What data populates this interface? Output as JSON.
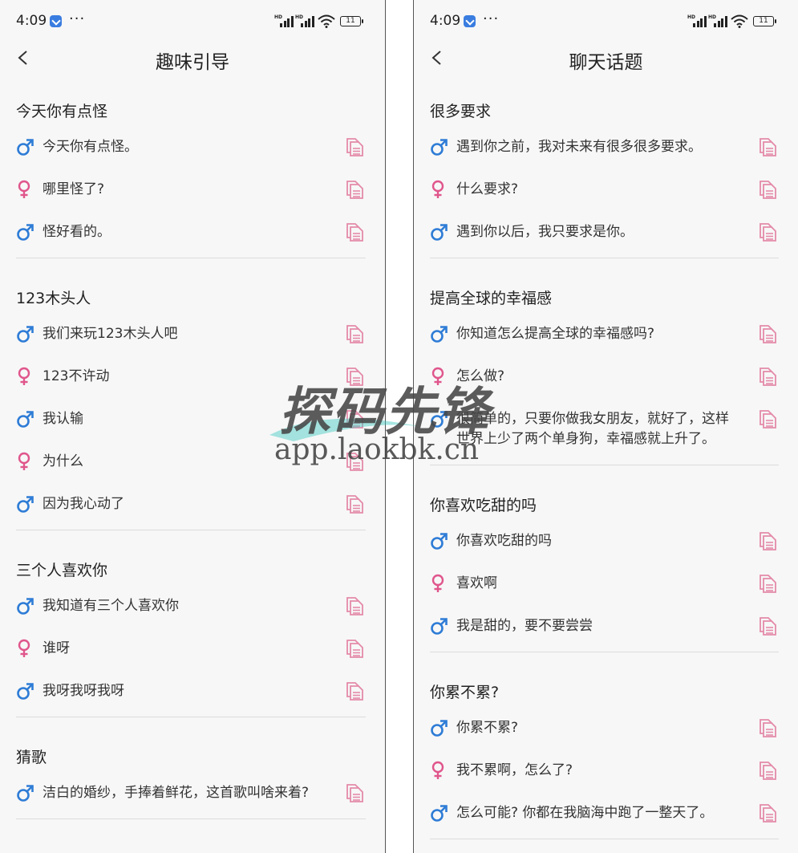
{
  "status": {
    "time": "4:09",
    "dots": "···",
    "battery": "11"
  },
  "colors": {
    "male": "#2e7cd6",
    "female": "#e0568c",
    "copy": "#e48aa8"
  },
  "screens": [
    {
      "title": "趣味引导",
      "sections": [
        {
          "title": "今天你有点怪",
          "items": [
            {
              "gender": "male",
              "text": "今天你有点怪。"
            },
            {
              "gender": "female",
              "text": "哪里怪了?"
            },
            {
              "gender": "male",
              "text": "怪好看的。"
            }
          ]
        },
        {
          "title": "123木头人",
          "items": [
            {
              "gender": "male",
              "text": "我们来玩123木头人吧"
            },
            {
              "gender": "female",
              "text": "123不许动"
            },
            {
              "gender": "male",
              "text": "我认输"
            },
            {
              "gender": "female",
              "text": "为什么"
            },
            {
              "gender": "male",
              "text": "因为我心动了"
            }
          ]
        },
        {
          "title": "三个人喜欢你",
          "items": [
            {
              "gender": "male",
              "text": "我知道有三个人喜欢你"
            },
            {
              "gender": "female",
              "text": "谁呀"
            },
            {
              "gender": "male",
              "text": "我呀我呀我呀"
            }
          ]
        },
        {
          "title": "猜歌",
          "items": [
            {
              "gender": "male",
              "text": "洁白的婚纱，手捧着鲜花，这首歌叫啥来着?"
            }
          ]
        }
      ]
    },
    {
      "title": "聊天话题",
      "sections": [
        {
          "title": "很多要求",
          "items": [
            {
              "gender": "male",
              "text": "遇到你之前，我对未来有很多很多要求。"
            },
            {
              "gender": "female",
              "text": "什么要求?"
            },
            {
              "gender": "male",
              "text": "遇到你以后，我只要求是你。"
            }
          ]
        },
        {
          "title": "提高全球的幸福感",
          "items": [
            {
              "gender": "male",
              "text": "你知道怎么提高全球的幸福感吗?"
            },
            {
              "gender": "female",
              "text": "怎么做?"
            },
            {
              "gender": "male",
              "text": "很简单的，只要你做我女朋友，就好了，这样世界上少了两个单身狗，幸福感就上升了。"
            }
          ]
        },
        {
          "title": "你喜欢吃甜的吗",
          "items": [
            {
              "gender": "male",
              "text": "你喜欢吃甜的吗"
            },
            {
              "gender": "female",
              "text": "喜欢啊"
            },
            {
              "gender": "male",
              "text": "我是甜的，要不要尝尝"
            }
          ]
        },
        {
          "title": "你累不累?",
          "items": [
            {
              "gender": "male",
              "text": "你累不累?"
            },
            {
              "gender": "female",
              "text": "我不累啊，怎么了?"
            },
            {
              "gender": "male",
              "text": "怎么可能? 你都在我脑海中跑了一整天了。"
            }
          ]
        }
      ]
    }
  ],
  "watermark": {
    "title": "探码先锋",
    "url": "app.laokbk.cn"
  }
}
